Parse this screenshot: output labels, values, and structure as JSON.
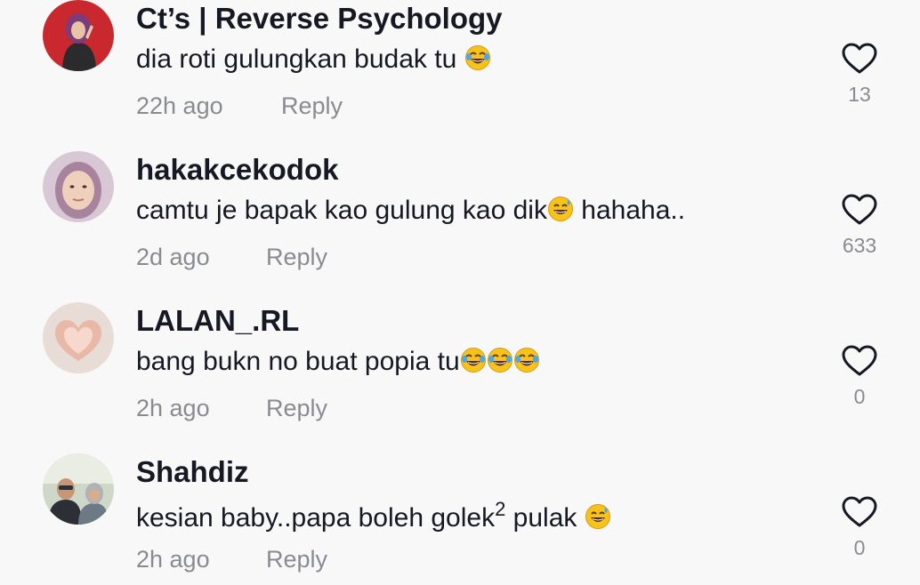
{
  "comments": [
    {
      "username": "Ct’s | Reverse Psychology",
      "text": "dia roti gulungkan budak tu ",
      "time": "22h ago",
      "reply_label": "Reply",
      "likes": "13"
    },
    {
      "username": "hakakcekodok",
      "text_before": "camtu je bapak kao gulung kao dik",
      "text_after": " hahaha..",
      "time": "2d ago",
      "reply_label": "Reply",
      "likes": "633"
    },
    {
      "username": "LALAN_.RL",
      "text": "bang bukn no buat popia tu",
      "time": "2h ago",
      "reply_label": "Reply",
      "likes": "0"
    },
    {
      "username": "Shahdiz",
      "text_before": "kesian baby..papa boleh golek",
      "superscript": "2",
      "text_after": " pulak ",
      "time": "2h ago",
      "reply_label": "Reply",
      "likes": "0"
    }
  ],
  "icons": {
    "like": "heart-outline-icon",
    "laugh": "face-with-tears-of-joy-emoji",
    "sweat": "grinning-face-with-sweat-emoji"
  },
  "colors": {
    "background": "#f8f8f8",
    "username": "#161823",
    "text": "#161823",
    "meta": "#8a8b91",
    "emoji": "#f7c21a"
  }
}
